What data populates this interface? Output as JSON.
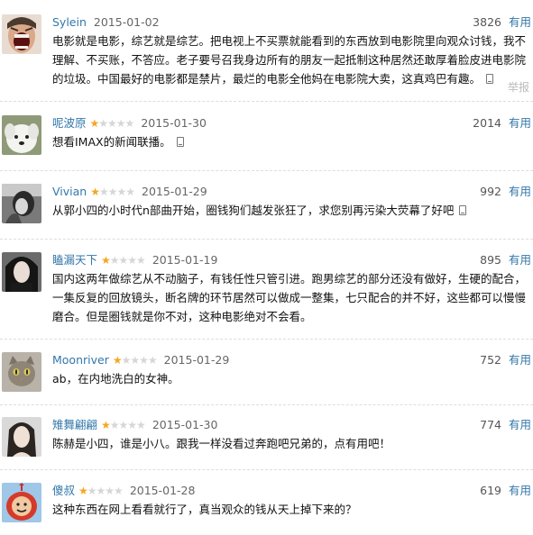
{
  "reviews": [
    {
      "user": "Sylein",
      "stars": 0,
      "date": "2015-01-02",
      "votes": "3826",
      "useful": "有用",
      "text": "电影就是电影，综艺就是综艺。把电视上不买票就能看到的东西放到电影院里向观众讨钱，我不理解、不买账，不答应。老子要号召我身边所有的朋友一起抵制这种居然还敢厚着脸皮进电影院的垃圾。中国最好的电影都是禁片，最烂的电影全他妈在电影院大卖，这真鸡巴有趣。",
      "report": "举报",
      "avatar": "screaming-face",
      "mobile": true
    },
    {
      "user": "呢波原",
      "stars": 1,
      "date": "2015-01-30",
      "votes": "2014",
      "useful": "有用",
      "text": "想看IMAX的新闻联播。",
      "avatar": "white-dog",
      "mobile": true
    },
    {
      "user": "Vivian",
      "stars": 1,
      "date": "2015-01-29",
      "votes": "992",
      "useful": "有用",
      "text": "从郭小四的小时代n部曲开始，圈钱狗们越发张狂了，求您别再污染大荧幕了好吧",
      "avatar": "grayscale-person",
      "mobile": true
    },
    {
      "user": "瞌漏天下",
      "stars": 1,
      "date": "2015-01-19",
      "votes": "895",
      "useful": "有用",
      "text": "国内这两年做综艺从不动脑子，有钱任性只管引进。跑男综艺的部分还没有做好，生硬的配合，一集反复的回放镜头，断名牌的环节居然可以做成一整集，七只配合的并不好，这些都可以慢慢磨合。但是圈钱就是你不对，这种电影绝对不会看。",
      "avatar": "woman-portrait",
      "mobile": false
    },
    {
      "user": "Moonriver",
      "stars": 1,
      "date": "2015-01-29",
      "votes": "752",
      "useful": "有用",
      "text": "ab，在内地洗白的女神。",
      "avatar": "cat",
      "mobile": false
    },
    {
      "user": "雉舞翩翩",
      "stars": 1,
      "date": "2015-01-30",
      "votes": "774",
      "useful": "有用",
      "text": "陈赫是小四，谁是小八。跟我一样没看过奔跑吧兄弟的，点有用吧！",
      "avatar": "woman-portrait-2",
      "mobile": false
    },
    {
      "user": "傻叔",
      "stars": 1,
      "date": "2015-01-28",
      "votes": "619",
      "useful": "有用",
      "text": "这种东西在网上看看就行了，真当观众的钱从天上掉下来的？",
      "avatar": "teletubby",
      "mobile": false
    }
  ],
  "colors": {
    "link": "#3377aa",
    "star_on": "#f5a623",
    "star_off": "#d6d6d6",
    "divider": "#dddddd"
  }
}
